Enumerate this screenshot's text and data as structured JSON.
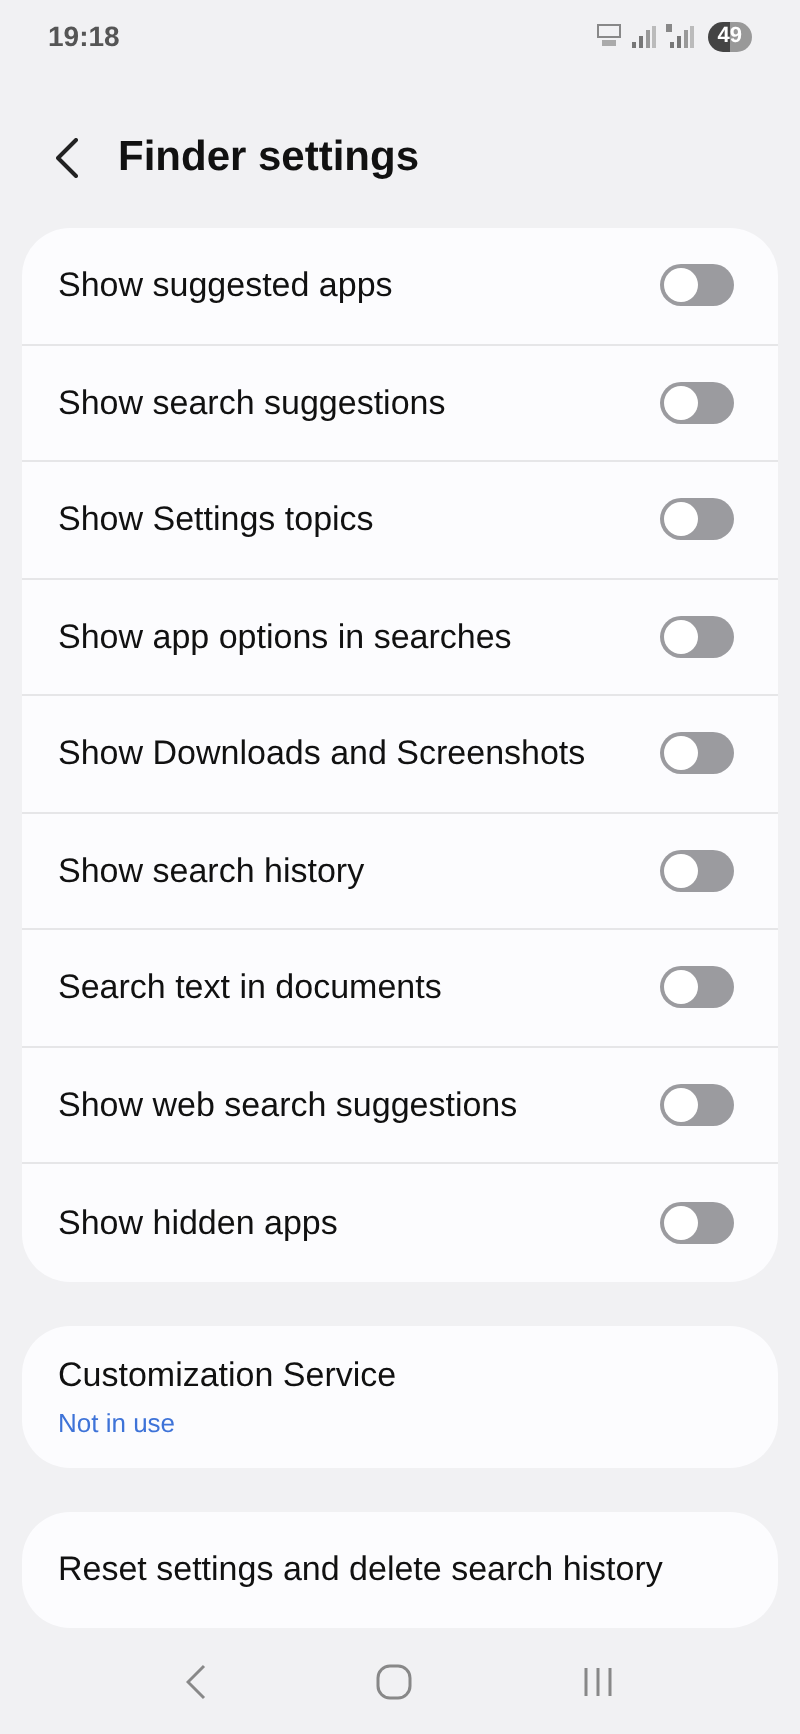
{
  "status_bar": {
    "time": "19:18",
    "battery": "49"
  },
  "header": {
    "title": "Finder settings"
  },
  "toggles": [
    {
      "label": "Show suggested apps",
      "on": false
    },
    {
      "label": "Show search suggestions",
      "on": false
    },
    {
      "label": "Show Settings topics",
      "on": false
    },
    {
      "label": "Show app options in searches",
      "on": false
    },
    {
      "label": "Show Downloads and Screenshots",
      "on": false
    },
    {
      "label": "Show search history",
      "on": false
    },
    {
      "label": "Search text in documents",
      "on": false
    },
    {
      "label": "Show web search suggestions",
      "on": false
    },
    {
      "label": "Show hidden apps",
      "on": false
    }
  ],
  "customization": {
    "title": "Customization Service",
    "subtitle": "Not in use"
  },
  "reset": {
    "label": "Reset settings and delete search history"
  }
}
